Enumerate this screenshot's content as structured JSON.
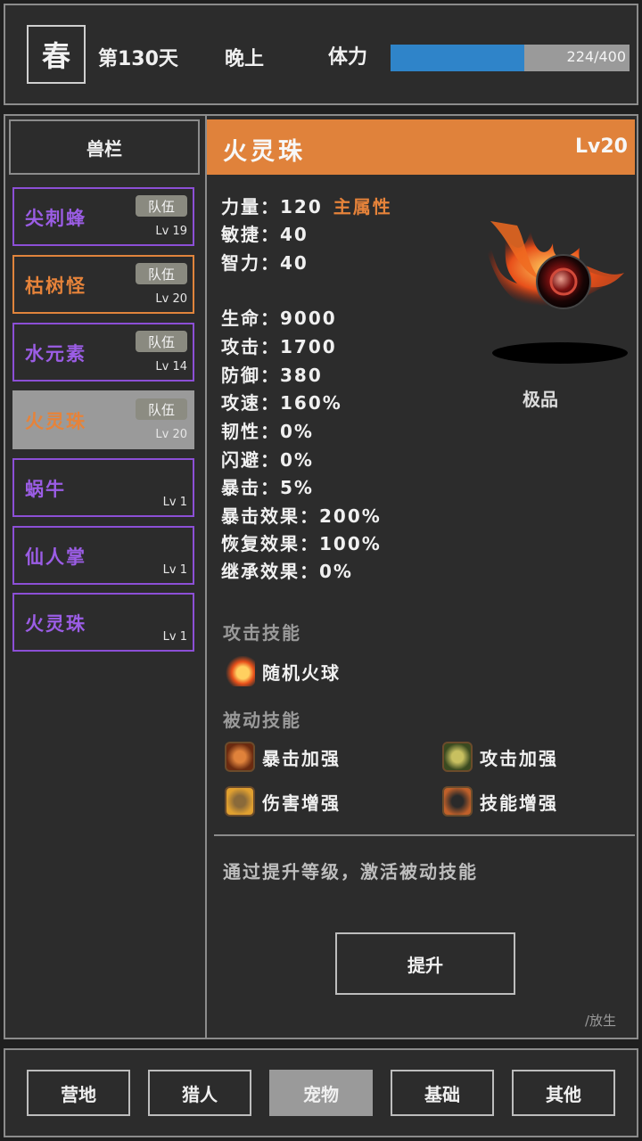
{
  "topbar": {
    "season": "春",
    "day": "第130天",
    "time": "晚上",
    "stamina_label": "体力",
    "stamina_text": "224/400",
    "stamina_fraction": 0.56
  },
  "sidebar": {
    "title": "兽栏",
    "pets": [
      {
        "name": "尖刺蜂",
        "badge": "队伍",
        "level": "Lv 19",
        "style": "purple"
      },
      {
        "name": "枯树怪",
        "badge": "队伍",
        "level": "Lv 20",
        "style": "orange"
      },
      {
        "name": "水元素",
        "badge": "队伍",
        "level": "Lv 14",
        "style": "purple"
      },
      {
        "name": "火灵珠",
        "badge": "队伍",
        "level": "Lv 20",
        "style": "selected"
      },
      {
        "name": "蜗牛",
        "badge": "",
        "level": "Lv 1",
        "style": "purple"
      },
      {
        "name": "仙人掌",
        "badge": "",
        "level": "Lv 1",
        "style": "purple"
      },
      {
        "name": "火灵珠",
        "badge": "",
        "level": "Lv 1",
        "style": "purple"
      }
    ]
  },
  "detail": {
    "name": "火灵珠",
    "level": "Lv20",
    "grade": "极品",
    "main_attr_tag": "主属性",
    "stats": [
      "力量：120",
      "敏捷：40",
      "智力：40",
      "生命：9000",
      "攻击：1700",
      "防御：380",
      "攻速：160%",
      "韧性：0%",
      "闪避：0%",
      "暴击：5%",
      "暴击效果：200%",
      "恢复效果：100%",
      "继承效果：0%"
    ],
    "attack_skill_title": "攻击技能",
    "attack_skill": "随机火球",
    "passive_skill_title": "被动技能",
    "passive_skills": [
      "暴击加强",
      "攻击加强",
      "伤害增强",
      "技能增强"
    ],
    "hint": "通过提升等级，激活被动技能",
    "upgrade_label": "提升",
    "release_label": "/放生"
  },
  "nav": {
    "items": [
      "营地",
      "猎人",
      "宠物",
      "基础",
      "其他"
    ],
    "active_index": 2
  },
  "colors": {
    "accent_orange": "#e0823b",
    "purple": "#8c4fd6",
    "stamina_blue": "#2f84c9"
  }
}
